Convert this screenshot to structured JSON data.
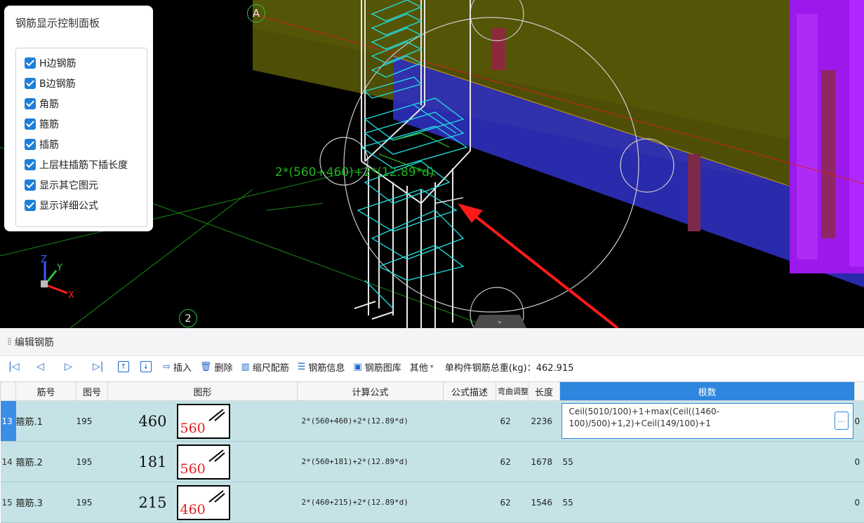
{
  "viewport": {
    "panel": {
      "title": "钢筋显示控制面板",
      "options": [
        {
          "label": "H边钢筋",
          "checked": true
        },
        {
          "label": "B边钢筋",
          "checked": true
        },
        {
          "label": "角筋",
          "checked": true
        },
        {
          "label": "箍筋",
          "checked": true
        },
        {
          "label": "插筋",
          "checked": true
        },
        {
          "label": "上层柱插筋下插长度",
          "checked": true
        },
        {
          "label": "显示其它图元",
          "checked": true
        },
        {
          "label": "显示详细公式",
          "checked": true
        }
      ]
    },
    "axis_labels": {
      "a": "A",
      "two": "2"
    },
    "formula_overlay": "2*(560+460)+2*(12.89*d)",
    "gizmo": {
      "z": "Z",
      "y": "Y",
      "x": "X"
    },
    "collapse_icon": "chevron-down-icon",
    "colors": {
      "background": "#000000",
      "beam_yellow": "#6b6b00",
      "beam_blue": "#3a3ad6",
      "wall_purple": "#a020f0",
      "stirrup_cyan": "#20e0e0"
    }
  },
  "editor": {
    "title": "编辑钢筋",
    "toolbar": {
      "nav": [
        "|◁",
        "◁",
        "▷",
        "▷|"
      ],
      "move_up": "↑",
      "move_down": "↓",
      "insert": "插入",
      "delete": "删除",
      "scale": "缩尺配筋",
      "info": "钢筋信息",
      "library": "钢筋图库",
      "other": "其他",
      "total_weight": "单构件钢筋总重(kg)：462.915"
    },
    "columns": [
      "筋号",
      "图号",
      "图形",
      "计算公式",
      "公式描述",
      "弯曲调整",
      "长度",
      "根数"
    ],
    "rows": [
      {
        "num": "13",
        "name": "箍筋.1",
        "fig_no": "195",
        "dim_a": "460",
        "dim_b": "560",
        "formula": "2*(560+460)+2*(12.89*d)",
        "desc": "",
        "bend": "62",
        "length": "2236",
        "count": "Ceil(5010/100)+1+max(Ceil((1460-100)/500)+1,2)+Ceil(149/100)+1",
        "extra": "0"
      },
      {
        "num": "14",
        "name": "箍筋.2",
        "fig_no": "195",
        "dim_a": "181",
        "dim_b": "560",
        "formula": "2*(560+181)+2*(12.89*d)",
        "desc": "",
        "bend": "62",
        "length": "1678",
        "count": "55",
        "extra": "0"
      },
      {
        "num": "15",
        "name": "箍筋.3",
        "fig_no": "195",
        "dim_a": "215",
        "dim_b": "460",
        "formula": "2*(460+215)+2*(12.89*d)",
        "desc": "",
        "bend": "62",
        "length": "1546",
        "count": "55",
        "extra": "0"
      }
    ]
  }
}
